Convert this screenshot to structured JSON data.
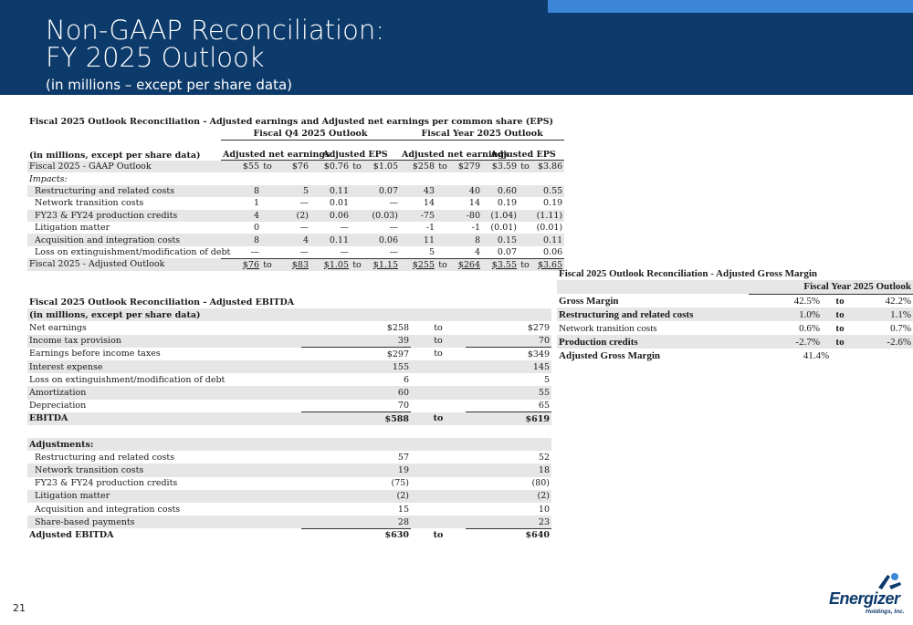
{
  "header": {
    "title_line1": "Non-GAAP Reconciliation:",
    "title_line2": "FY 2025 Outlook",
    "subtitle": "(in millions – except per share data)"
  },
  "colors": {
    "navy": "#0c3a6b",
    "accent_blue": "#3b86d6",
    "band_gray": "#e6e6e6"
  },
  "eps": {
    "caption": "Fiscal 2025 Outlook Reconciliation - Adjusted earnings and Adjusted net earnings per common share (EPS)",
    "group_q4": "Fiscal Q4 2025 Outlook",
    "group_fy": "Fiscal Year 2025 Outlook",
    "row_label_header": "(in millions, except per share data)",
    "col_net_earnings": "Adjusted net earnings",
    "col_eps": "Adjusted EPS",
    "to": "to",
    "gaap": {
      "label": "Fiscal 2025 - GAAP Outlook",
      "v": [
        "$55",
        "$76",
        "$0.76",
        "$1.05",
        "$258",
        "$279",
        "$3.59",
        "$3.86"
      ]
    },
    "impacts_label": "Impacts:",
    "rows": [
      {
        "label": "Restructuring and related costs",
        "v": [
          "8",
          "5",
          "0.11",
          "0.07",
          "43",
          "40",
          "0.60",
          "0.55"
        ]
      },
      {
        "label": "Network transition costs",
        "v": [
          "1",
          "—",
          "0.01",
          "—",
          "14",
          "14",
          "0.19",
          "0.19"
        ]
      },
      {
        "label": "FY23 & FY24 production credits",
        "v": [
          "4",
          "(2)",
          "0.06",
          "(0.03)",
          "-75",
          "-80",
          "(1.04)",
          "(1.11)"
        ]
      },
      {
        "label": "Litigation matter",
        "v": [
          "0",
          "—",
          "—",
          "—",
          "-1",
          "-1",
          "(0.01)",
          "(0.01)"
        ]
      },
      {
        "label": "Acquisition and integration costs",
        "v": [
          "8",
          "4",
          "0.11",
          "0.06",
          "11",
          "8",
          "0.15",
          "0.11"
        ]
      },
      {
        "label": "Loss on extinguishment/modification of debt",
        "v": [
          "—",
          "—",
          "—",
          "—",
          "5",
          "4",
          "0.07",
          "0.06"
        ]
      }
    ],
    "adjusted": {
      "label": "Fiscal 2025 - Adjusted Outlook",
      "v": [
        "$76",
        "$83",
        "$1.05",
        "$1.15",
        "$255",
        "$264",
        "$3.55",
        "$3.65"
      ]
    }
  },
  "ebitda": {
    "caption": "Fiscal 2025 Outlook Reconciliation - Adjusted EBITDA",
    "row_label_header": "(in millions, except per share data)",
    "to": "to",
    "rows": [
      {
        "label": "Net earnings",
        "low": "$258",
        "to": "to",
        "high": "$279"
      },
      {
        "label": "Income tax provision",
        "low": "39",
        "to": "to",
        "high": "70"
      },
      {
        "label": "Earnings before income taxes",
        "low": "$297",
        "to": "to",
        "high": "$349"
      },
      {
        "label": "Interest expense",
        "low": "155",
        "to": "",
        "high": "145"
      },
      {
        "label": "Loss on extinguishment/modification of debt",
        "low": "6",
        "to": "",
        "high": "5"
      },
      {
        "label": "Amortization",
        "low": "60",
        "to": "",
        "high": "55"
      },
      {
        "label": "Depreciation",
        "low": "70",
        "to": "",
        "high": "65"
      }
    ],
    "ebitda_total": {
      "label": "EBITDA",
      "low": "$588",
      "to": "to",
      "high": "$619"
    },
    "adjustments_label": "Adjustments:",
    "adjustments": [
      {
        "label": "Restructuring and related costs",
        "low": "57",
        "high": "52"
      },
      {
        "label": "Network transition costs",
        "low": "19",
        "high": "18"
      },
      {
        "label": "FY23 & FY24 production credits",
        "low": "(75)",
        "high": "(80)"
      },
      {
        "label": "Litigation matter",
        "low": "(2)",
        "high": "(2)"
      },
      {
        "label": "Acquisition and integration costs",
        "low": "15",
        "high": "10"
      },
      {
        "label": "Share-based payments",
        "low": "28",
        "high": "23"
      }
    ],
    "adjusted_total": {
      "label": "Adjusted EBITDA",
      "low": "$630",
      "to": "to",
      "high": "$640"
    }
  },
  "gross_margin": {
    "caption": "Fiscal 2025 Outlook Reconciliation - Adjusted Gross Margin",
    "header": "Fiscal Year 2025 Outlook",
    "rows": [
      {
        "label": "Gross Margin",
        "low": "42.5%",
        "to": "to",
        "high": "42.2%"
      },
      {
        "label": "Restructuring and related costs",
        "low": "1.0%",
        "to": "to",
        "high": "1.1%"
      },
      {
        "label": "Network transition costs",
        "low": "0.6%",
        "to": "to",
        "high": "0.7%"
      },
      {
        "label": "Production credits",
        "low": "-2.7%",
        "to": "to",
        "high": "-2.6%"
      }
    ],
    "adjusted": {
      "label": "Adjusted Gross Margin",
      "value": "41.4%"
    }
  },
  "footer": {
    "page_number": "21",
    "logo_word": "Energizer",
    "logo_sub": "Holdings, Inc."
  }
}
